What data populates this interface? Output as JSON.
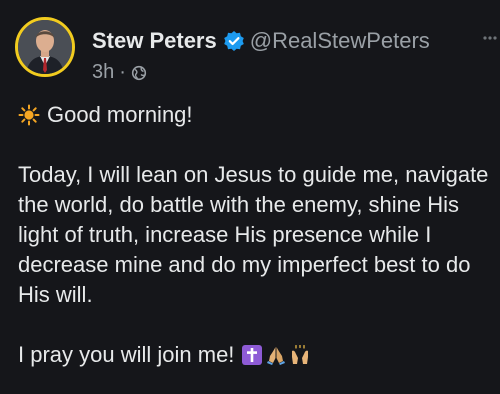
{
  "post": {
    "author": {
      "display_name": "Stew Peters",
      "handle": "@RealStewPeters",
      "verified": true,
      "avatar_ring_color": "#f2cc1f",
      "verified_color": "#1d9bf0"
    },
    "meta": {
      "time": "3h",
      "separator": "·",
      "visibility_icon": "globe-icon"
    },
    "more_icon": "more-options-icon",
    "greeting": {
      "icon": "sun-emoji",
      "text": "Good morning!"
    },
    "body": "Today, I will lean on Jesus to guide me, navigate the world, do battle with the enemy, shine His light of truth, increase His presence while I decrease mine and do my imperfect best to do His will.",
    "closing": {
      "text": "I pray you will join me!",
      "emojis": [
        "latin-cross-emoji",
        "folded-hands-emoji",
        "raised-hands-emoji"
      ]
    }
  },
  "colors": {
    "background": "#15161a",
    "text": "#e7e9ea",
    "secondary_text": "#9aa0a6"
  }
}
